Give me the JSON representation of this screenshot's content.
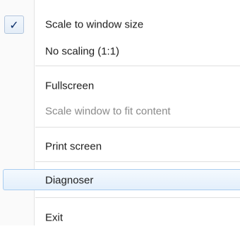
{
  "menu": {
    "items": [
      {
        "label": "Scale to window size",
        "checked": true,
        "enabled": true
      },
      {
        "label": "No scaling (1:1)",
        "checked": false,
        "enabled": true
      },
      {
        "label": "Fullscreen",
        "checked": false,
        "enabled": true
      },
      {
        "label": "Scale window to fit content",
        "checked": false,
        "enabled": false
      },
      {
        "label": "Print screen",
        "checked": false,
        "enabled": true
      },
      {
        "label": "Diagnoser",
        "checked": false,
        "enabled": true,
        "hovered": true
      },
      {
        "label": "Exit",
        "checked": false,
        "enabled": true
      }
    ],
    "check_glyph": "✓",
    "colors": {
      "highlight_border": "#a9cdf0",
      "check_color": "#0b2f6a",
      "disabled_text": "#8a8a8a"
    }
  }
}
